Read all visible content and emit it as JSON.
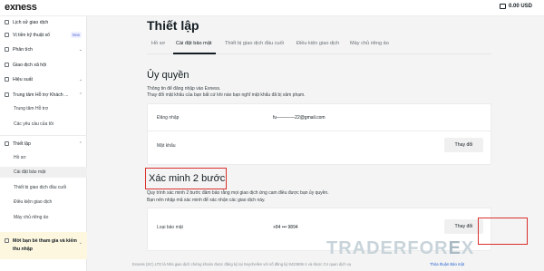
{
  "header": {
    "logo": "exness",
    "balance": "0.00 USD",
    "wallet_icon": "wallet-icon"
  },
  "sidebar": {
    "items": [
      {
        "label": "Lịch sử giao dịch",
        "icon": "history-icon"
      },
      {
        "label": "Vị tiền kỹ thuật số",
        "icon": "crypto-icon",
        "badge": "New"
      },
      {
        "label": "Phân tích",
        "icon": "analytics-icon"
      },
      {
        "label": "Giao dịch xã hội",
        "icon": "social-icon"
      },
      {
        "label": "Hiệu suất",
        "icon": "performance-icon"
      },
      {
        "label": "Trung tâm Hỗ trợ Khách ...",
        "icon": "support-icon"
      },
      {
        "label": "Thiết lập",
        "icon": "settings-icon"
      }
    ],
    "support_sub": [
      "Trung tâm Hỗ trợ",
      "Các yêu cầu của tôi"
    ],
    "settings_sub": [
      "Hồ sơ",
      "Cài đặt bảo mật",
      "Thiết bị giao dịch đầu cuối",
      "Điều kiện giao dịch",
      "Máy chủ riêng ảo"
    ],
    "invite_label": "Mời bạn bè tham gia và kiếm thu nhập"
  },
  "main": {
    "title": "Thiết lập",
    "tabs": [
      "Hồ sơ",
      "Cài đặt bảo mật",
      "Thiết bị giao dịch đầu cuối",
      "Điều kiện giao dịch",
      "Máy chủ riêng ảo"
    ],
    "active_tab": "Cài đặt bảo mật",
    "authorization": {
      "title": "Ủy quyền",
      "desc1": "Thông tin để đăng nhập vào Exness.",
      "desc2": "Thay đổi mật khẩu của bạn bất cứ khi nào bạn nghĩ mật khẩu đã bị xâm phạm.",
      "login_label": "Đăng nhập",
      "login_value": "fu————22@gmail.com",
      "password_label": "Mật khẩu",
      "change_button": "Thay đổi"
    },
    "two_step": {
      "title": "Xác minh 2 bước",
      "desc1": "Quy trình xác minh 2 bước đảm bảo rằng mọi giao dịch ứng cam điều được bạn ủy quyền.",
      "desc2": "Bạn nên nhập mã xác minh để xác nhận các giao dịch này.",
      "type_label": "Loại bảo mật",
      "type_value": "+84 ••• 9894",
      "change_button": "Thay đổi"
    }
  },
  "watermark": {
    "part1": "TRADER",
    "part2": "F",
    "part3": "OR",
    "x": "E",
    "part4": "X"
  },
  "footer": {
    "text": "Exness (SC) LTD là Nhà giao dịch chứng khoán được đăng ký tại Seychelles với số đăng ký 8423606-1 và được Cơ quan dịch vụ",
    "link": "Thỏa thuận Bảo mật"
  },
  "colors": {
    "accent_red": "#d9302d",
    "invite_bg": "#fdf7e0",
    "link": "#1d5fcf"
  }
}
